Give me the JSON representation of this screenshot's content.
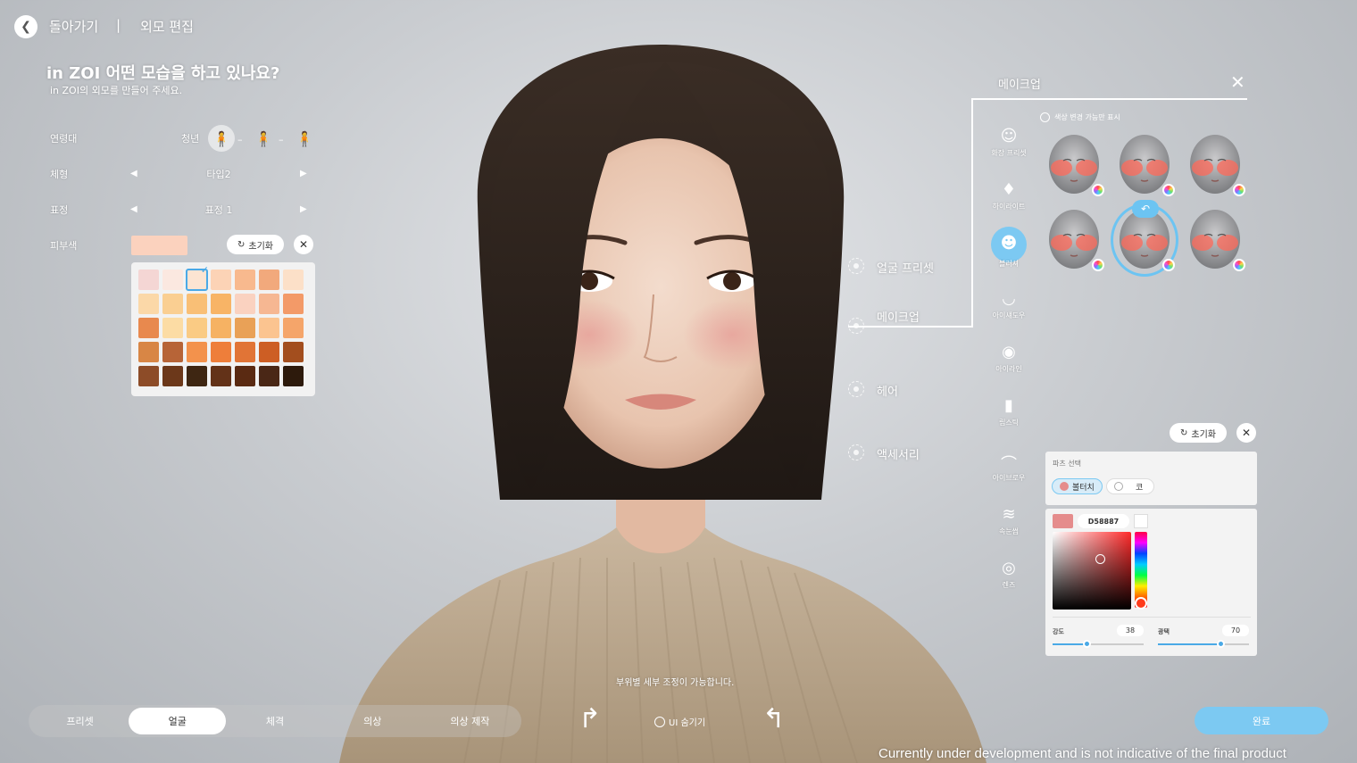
{
  "topbar": {
    "back_label": "돌아가기",
    "separator": "|",
    "title": "외모 편집"
  },
  "intro": {
    "heading": "in ZOI 어떤 모습을 하고 있나요?",
    "subheading": "in ZOI의 외모를 만들어 주세요."
  },
  "rows": {
    "age": {
      "label": "연령대",
      "value": "청년"
    },
    "body": {
      "label": "체형",
      "value": "타입2"
    },
    "expression": {
      "label": "표정",
      "value": "표정 1"
    },
    "skin": {
      "label": "피부색",
      "current_color": "#FBD2BE",
      "reset_label": "초기화"
    }
  },
  "skin_palette": {
    "selected_index": 2,
    "colors": [
      "#F4D6D4",
      "#FBE8E0",
      "#FCE4D2",
      "#FCD3B6",
      "#F8B98E",
      "#F2A97C",
      "#FCE0C8",
      "#FBD8A8",
      "#FACF92",
      "#F9BF76",
      "#F8B466",
      "#FAD2C0",
      "#F6B792",
      "#F39A68",
      "#E8894E",
      "#FCDCA4",
      "#FACB84",
      "#F6B263",
      "#E9A157",
      "#FBC490",
      "#F5A56A",
      "#D88645",
      "#B76437",
      "#F3924C",
      "#EE7E3A",
      "#E17436",
      "#CD5E24",
      "#A34E1E",
      "#8D4C28",
      "#6C381A",
      "#3E2612",
      "#633218",
      "#5A2A12",
      "#4A2716",
      "#2D1A0C"
    ]
  },
  "categories": [
    {
      "label": "얼굴 프리셋"
    },
    {
      "label": "메이크업"
    },
    {
      "label": "헤어"
    },
    {
      "label": "액세서리"
    }
  ],
  "makeup_panel": {
    "title": "메이크업",
    "filter_label": "색상 변경 가능만 표시",
    "sub_items": [
      {
        "label": "화장 프리셋",
        "icon": "face-preset-icon"
      },
      {
        "label": "하이라이트",
        "icon": "highlight-icon"
      },
      {
        "label": "블러셔",
        "icon": "blusher-icon"
      },
      {
        "label": "아이섀도우",
        "icon": "eyeshadow-icon"
      },
      {
        "label": "아이라인",
        "icon": "eyeliner-icon"
      },
      {
        "label": "립스틱",
        "icon": "lipstick-icon"
      },
      {
        "label": "아이브로우",
        "icon": "eyebrow-icon"
      },
      {
        "label": "속눈썹",
        "icon": "eyelash-icon"
      },
      {
        "label": "렌즈",
        "icon": "lens-icon"
      }
    ],
    "active_sub_item": "블러셔",
    "selected_thumbnail": 4,
    "reset_label": "초기화"
  },
  "color_editor": {
    "parts_title": "파츠 선택",
    "parts": [
      {
        "label": "볼터치",
        "selected": true,
        "color": "#E58C8C"
      },
      {
        "label": "코",
        "selected": false,
        "color": "#FFFFFF"
      }
    ],
    "hex": "D58887",
    "swatch_color": "#E58C8C",
    "intensity": {
      "label": "강도",
      "value": "38"
    },
    "gloss": {
      "label": "광택",
      "value": "70"
    }
  },
  "bottom": {
    "tabs": [
      "프리셋",
      "얼굴",
      "체격",
      "의상",
      "의상 제작"
    ],
    "active_tab": 1,
    "hide_ui_label": "UI 숨기기",
    "hint": "부위별 세부 조정이 가능합니다.",
    "done_label": "완료"
  },
  "disclaimer": "Currently under development and is not indicative of the final product"
}
